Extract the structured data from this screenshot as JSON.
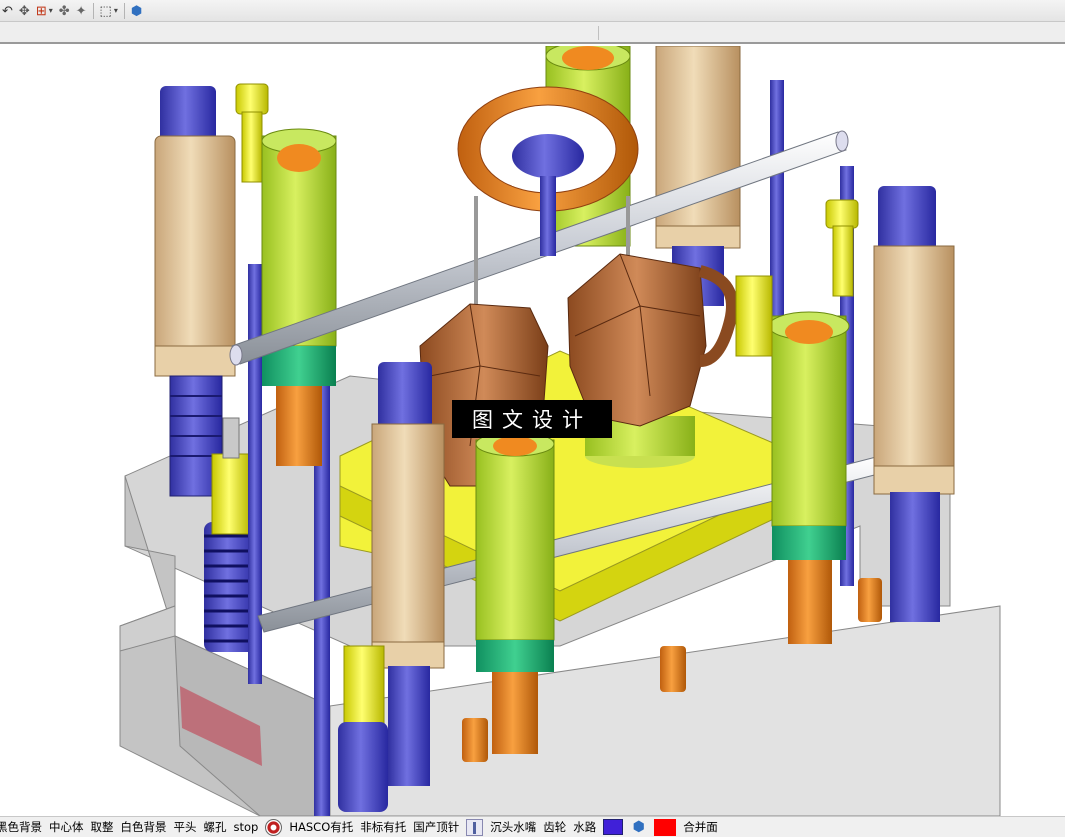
{
  "top_toolbar": {
    "icons": [
      "move-icon",
      "snap-icon",
      "constraint-icon",
      "transform-icon",
      "selection-box-icon",
      "view-cube-icon"
    ]
  },
  "watermark": {
    "text": "图文设计"
  },
  "bottom_toolbar": {
    "items": [
      "黑色背景",
      "中心体",
      "取整",
      "白色背景",
      "平头",
      "螺孔",
      "stop",
      "HASCO有托",
      "非标有托",
      "国产顶针",
      "沉头水嘴",
      "齿轮",
      "水路",
      "合并面"
    ],
    "icons": [
      "target-icon",
      "ejector-pin-icon",
      "blue-square-icon",
      "cube-icon",
      "red-square-icon"
    ],
    "colors": {
      "blue_square": "#4020d8",
      "red_square": "#ff0000"
    }
  },
  "colors": {
    "plate_gray": "#d2d2d2",
    "yellow_plate": "#f5f53c",
    "pillar_beige": "#d6b88e",
    "pillar_blue": "#4848c0",
    "pillar_green": "#b8dc3a",
    "pillar_orange": "#e07a18",
    "part_brown": "#b87040",
    "ring_orange": "#e0784a"
  }
}
